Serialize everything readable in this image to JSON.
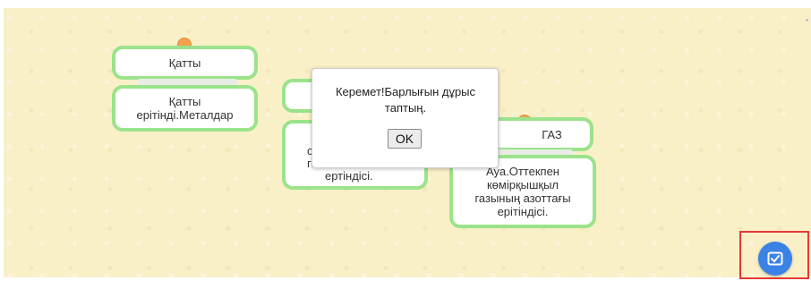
{
  "cards": {
    "solid_header": "Қатты",
    "solid_body": "Қатты ерітінді.Металдар",
    "liquid_body_partial_1": "су",
    "liquid_body_partial_2": "га",
    "liquid_body_end": "ертіндісі.",
    "gas_header": "ГАЗ",
    "gas_body": "Ауа.Оттекпен көмірқышқыл газының азоттағы ерітіндісі."
  },
  "dialog": {
    "message": "Керемет!Барлығын дұрыс таптың.",
    "ok_label": "OK"
  },
  "colors": {
    "card_border": "#9be38a",
    "pin": "#f4a14f",
    "check_button": "#3b82e6",
    "highlight_frame": "#e53935",
    "board_background": "#faf0c8"
  },
  "icons": {
    "check_button_icon": "check-square-icon"
  }
}
